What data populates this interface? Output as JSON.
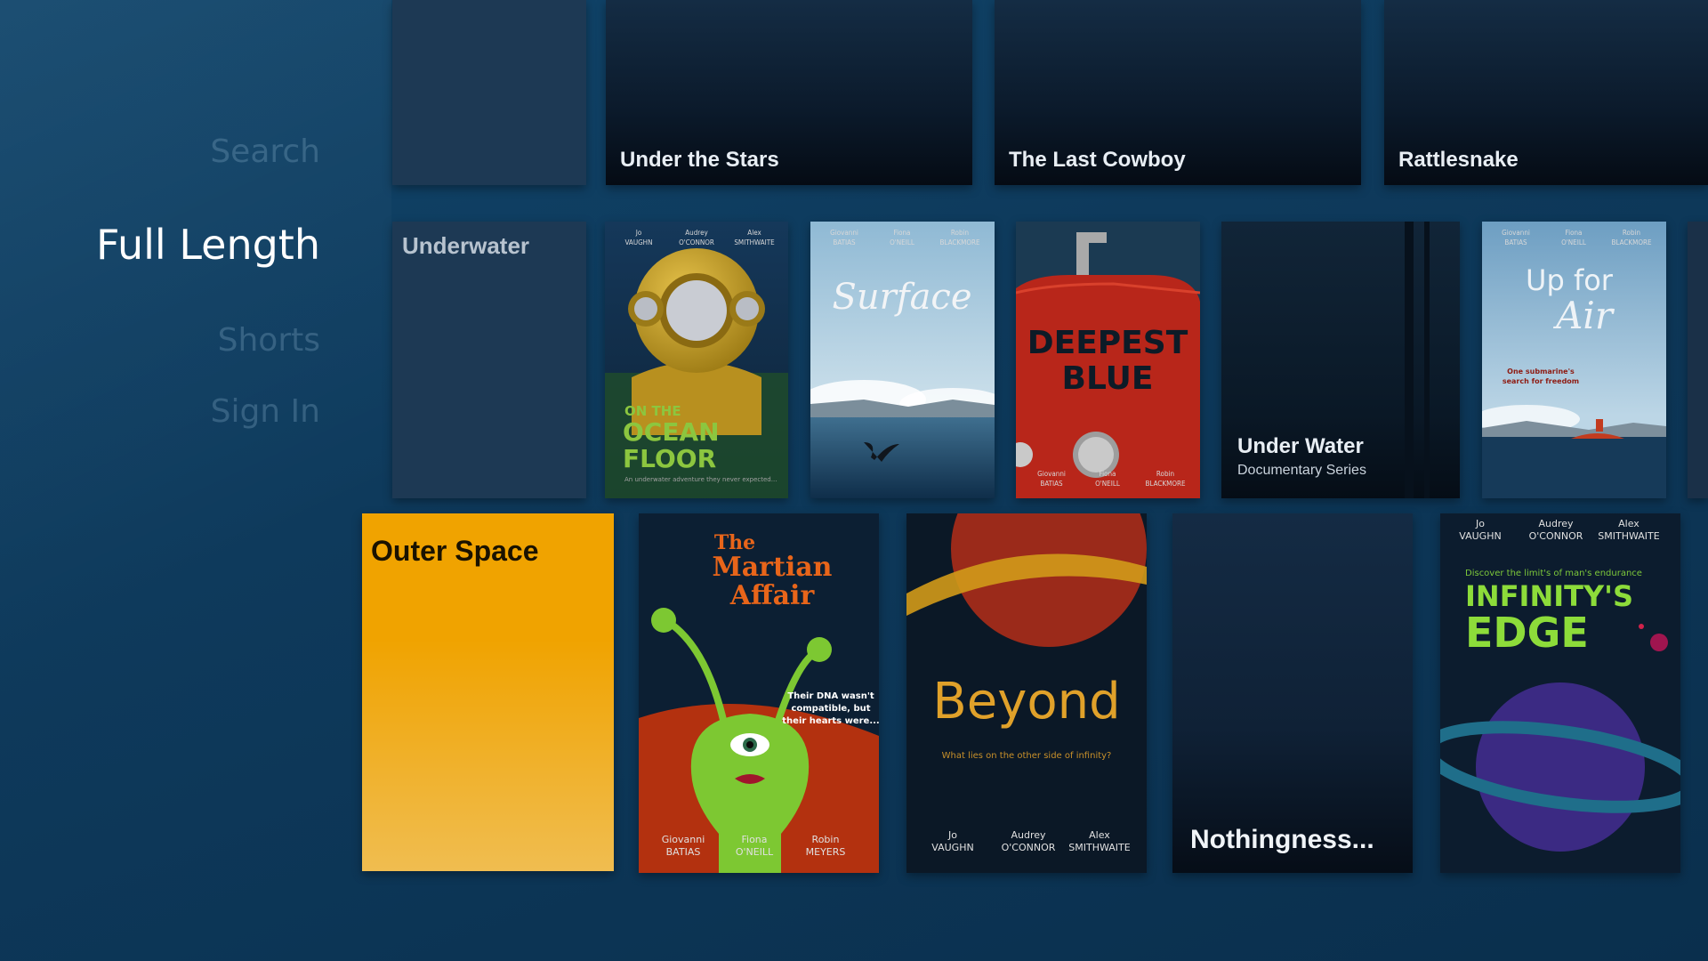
{
  "nav": {
    "search": "Search",
    "full_length": "Full Length",
    "shorts": "Shorts",
    "sign_in": "Sign In"
  },
  "row1": {
    "tiles": [
      {
        "title": "Under the Stars"
      },
      {
        "title": "The Last Cowboy"
      },
      {
        "title": "Rattlesnake"
      }
    ]
  },
  "row2": {
    "category": "Underwater",
    "ocean_floor": {
      "credits": [
        "Jo",
        "VAUGHN",
        "Audrey",
        "O'CONNOR",
        "Alex",
        "SMITHWAITE"
      ],
      "title_small": "ON THE",
      "title_line1": "OCEAN",
      "title_line2": "FLOOR",
      "tagline": "An underwater adventure they never expected..."
    },
    "surface": {
      "credits": [
        "Giovanni",
        "BATIAS",
        "Fiona",
        "O'NEILL",
        "Robin",
        "BLACKMORE"
      ],
      "title": "Surface"
    },
    "deepest_blue": {
      "title_line1": "DEEPEST",
      "title_line2": "BLUE",
      "credits": [
        "Giovanni",
        "BATIAS",
        "Fiona",
        "O'NEILL",
        "Robin",
        "BLACKMORE"
      ]
    },
    "under_water": {
      "title": "Under Water",
      "subtitle": "Documentary Series"
    },
    "up_for_air": {
      "credits": [
        "Giovanni",
        "BATIAS",
        "Fiona",
        "O'NEILL",
        "Robin",
        "BLACKMORE"
      ],
      "title_line1": "Up for",
      "title_line2": "Air",
      "tagline_line1": "One submarine's",
      "tagline_line2": "search for freedom"
    }
  },
  "row3": {
    "category": "Outer Space",
    "martian": {
      "title_line1": "The",
      "title_line2": "Martian",
      "title_line3": "Affair",
      "tagline_line1": "Their DNA wasn't",
      "tagline_line2": "compatible, but",
      "tagline_line3": "their hearts were...",
      "credits": [
        "Giovanni",
        "BATIAS",
        "Fiona",
        "O'NEILL",
        "Robin",
        "MEYERS"
      ]
    },
    "beyond": {
      "title": "Beyond",
      "tagline": "What lies on the other side of infinity?",
      "credits": [
        "Jo",
        "VAUGHN",
        "Audrey",
        "O'CONNOR",
        "Alex",
        "SMITHWAITE"
      ]
    },
    "nothingness": {
      "title": "Nothingness..."
    },
    "infinity": {
      "credits": [
        "Jo",
        "VAUGHN",
        "Audrey",
        "O'CONNOR",
        "Alex",
        "SMITHWAITE"
      ],
      "tagline": "Discover the limit's of man's endurance",
      "title_line1": "INFINITY'S",
      "title_line2": "EDGE"
    }
  },
  "colors": {
    "background": "#0f3a5c",
    "focus_tile": "#f0a500",
    "nav_active": "#ffffff",
    "nav_inactive": "#3f6a8c"
  }
}
